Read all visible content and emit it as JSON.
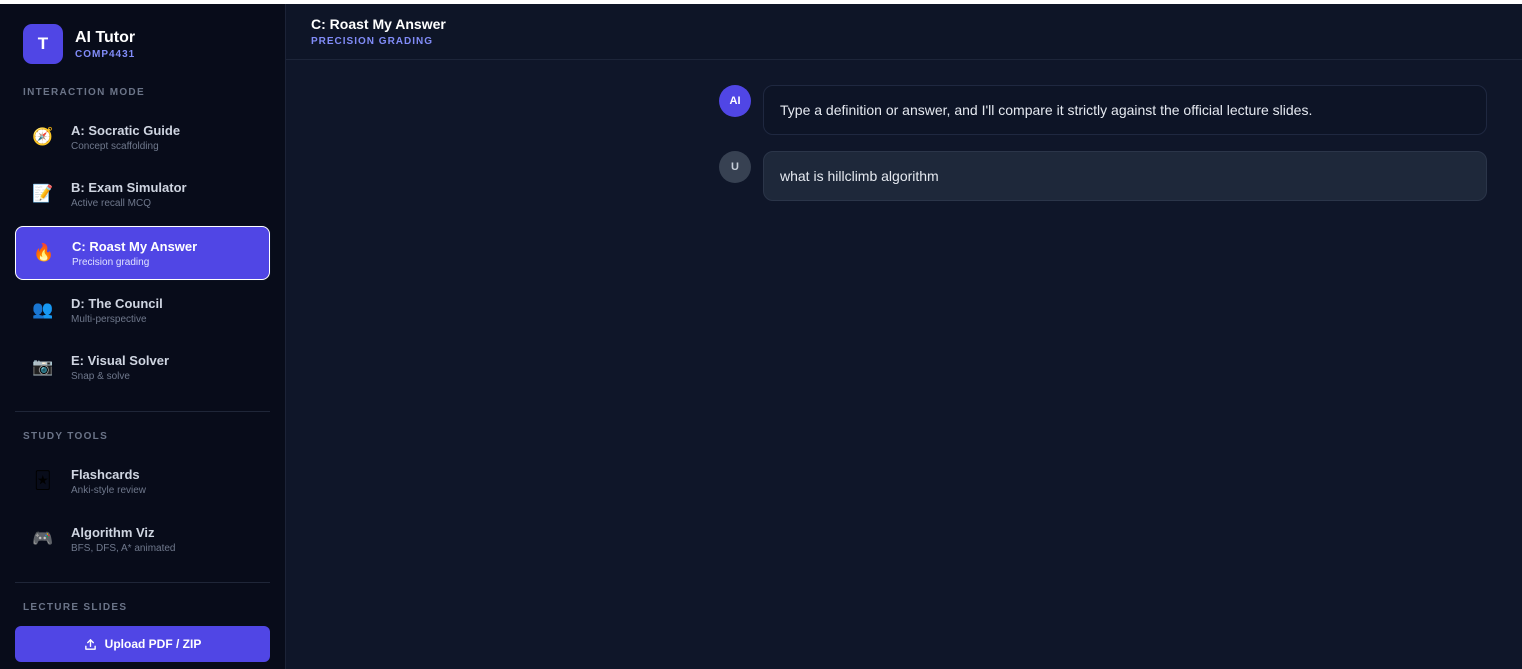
{
  "brand": {
    "avatar": "T",
    "title": "AI Tutor",
    "course": "COMP4431"
  },
  "sections": {
    "interaction_mode": "INTERACTION MODE",
    "study_tools": "STUDY TOOLS",
    "lecture_slides": "LECTURE SLIDES"
  },
  "modes": [
    {
      "title": "A: Socratic Guide",
      "desc": "Concept scaffolding",
      "icon": "compass-icon",
      "glyph": "🧭",
      "active": false
    },
    {
      "title": "B: Exam Simulator",
      "desc": "Active recall MCQ",
      "icon": "memo-icon",
      "glyph": "📝",
      "active": false
    },
    {
      "title": "C: Roast My Answer",
      "desc": "Precision grading",
      "icon": "fire-icon",
      "glyph": "🔥",
      "active": true
    },
    {
      "title": "D: The Council",
      "desc": "Multi-perspective",
      "icon": "people-icon",
      "glyph": "👥",
      "active": false
    },
    {
      "title": "E: Visual Solver",
      "desc": "Snap & solve",
      "icon": "camera-icon",
      "glyph": "📷",
      "active": false
    }
  ],
  "tools": [
    {
      "title": "Flashcards",
      "desc": "Anki-style review",
      "icon": "cards-icon",
      "glyph": "🃏"
    },
    {
      "title": "Algorithm Viz",
      "desc": "BFS, DFS, A* animated",
      "icon": "gamepad-icon",
      "glyph": "🎮"
    }
  ],
  "upload": {
    "label": "Upload PDF / ZIP",
    "icon": "upload-icon"
  },
  "header": {
    "title": "C: Roast My Answer",
    "subtitle": "PRECISION GRADING"
  },
  "messages": [
    {
      "role": "ai",
      "avatar": "AI",
      "text": "Type a definition or answer, and I'll compare it strictly against the official lecture slides."
    },
    {
      "role": "user",
      "avatar": "U",
      "text": "what is hillclimb algorithm"
    }
  ],
  "colors": {
    "accent": "#5046e5",
    "sidebar_bg": "#080c1a",
    "main_bg": "#0f1629",
    "accent_text": "#818cf8"
  }
}
